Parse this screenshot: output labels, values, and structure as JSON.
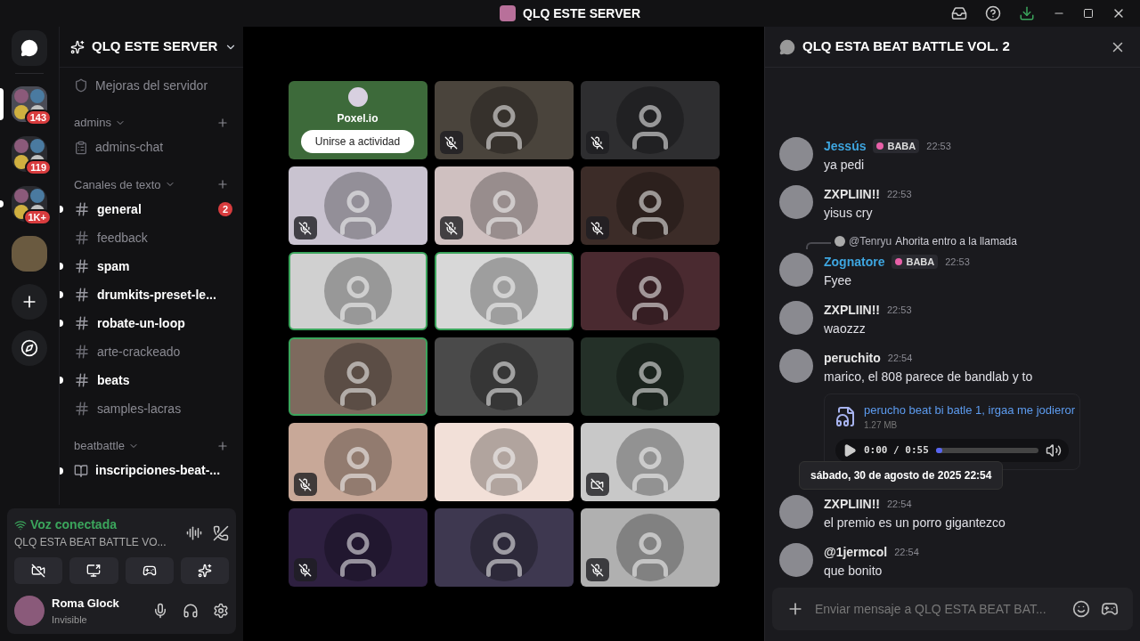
{
  "window": {
    "title": "QLQ ESTE SERVER"
  },
  "servers": [
    {
      "kind": "folder",
      "badge": "143",
      "selected": true,
      "unread": false
    },
    {
      "kind": "folder",
      "badge": "119",
      "selected": false,
      "unread": false
    },
    {
      "kind": "folder",
      "badge": "1K+",
      "selected": false,
      "unread": true
    },
    {
      "kind": "server",
      "selected": false,
      "unread": false
    }
  ],
  "sidebar": {
    "server_name": "QLQ ESTE SERVER",
    "items": [
      {
        "kind": "boost",
        "name": "Mejoras del servidor",
        "unread": false
      },
      {
        "kind": "category",
        "name": "admins"
      },
      {
        "kind": "forum",
        "name": "admins-chat",
        "unread": false
      },
      {
        "kind": "category",
        "name": "Canales de texto"
      },
      {
        "kind": "text",
        "name": "general",
        "unread": true,
        "badge": "2"
      },
      {
        "kind": "text",
        "name": "feedback",
        "unread": false
      },
      {
        "kind": "text",
        "name": "spam",
        "unread": true
      },
      {
        "kind": "text",
        "name": "drumkits-preset-le...",
        "unread": true
      },
      {
        "kind": "text",
        "name": "robate-un-loop",
        "unread": true
      },
      {
        "kind": "text",
        "name": "arte-crackeado",
        "unread": false
      },
      {
        "kind": "text",
        "name": "beats",
        "unread": true
      },
      {
        "kind": "text",
        "name": "samples-lacras",
        "unread": false
      },
      {
        "kind": "category",
        "name": "beatbattle"
      },
      {
        "kind": "rules",
        "name": "inscripciones-beat-...",
        "unread": true
      }
    ]
  },
  "voice": {
    "status": "Voz conectada",
    "channel": "QLQ ESTA BEAT BATTLE VO..."
  },
  "user": {
    "name": "Roma Glock",
    "status": "Invisible"
  },
  "tiles": [
    {
      "kind": "activity",
      "title": "Poxel.io",
      "button": "Unirse a actividad",
      "color": "#3d6a3a",
      "speaking": false
    },
    {
      "kind": "user",
      "color": "#4a443c",
      "speaking": false,
      "muted": true,
      "camera_off": false
    },
    {
      "kind": "user",
      "color": "#2e2e30",
      "speaking": false,
      "muted": true,
      "camera_off": false
    },
    {
      "kind": "user",
      "color": "#c9c3d0",
      "speaking": false,
      "muted": true,
      "camera_off": false
    },
    {
      "kind": "user",
      "color": "#cfc0c0",
      "speaking": false,
      "muted": true,
      "camera_off": false
    },
    {
      "kind": "user",
      "color": "#3c2c28",
      "speaking": false,
      "muted": true,
      "camera_off": false
    },
    {
      "kind": "user",
      "color": "#d0d0d0",
      "speaking": true,
      "muted": false,
      "camera_off": false
    },
    {
      "kind": "user",
      "color": "#d8d8d8",
      "speaking": true,
      "muted": false,
      "camera_off": false
    },
    {
      "kind": "user",
      "color": "#4a2a30",
      "speaking": false,
      "muted": false,
      "camera_off": false
    },
    {
      "kind": "user",
      "color": "#7d6a5e",
      "speaking": true,
      "muted": false,
      "camera_off": false
    },
    {
      "kind": "user",
      "color": "#4a4a4a",
      "speaking": false,
      "muted": false,
      "camera_off": false
    },
    {
      "kind": "user",
      "color": "#243028",
      "speaking": false,
      "muted": false,
      "camera_off": false
    },
    {
      "kind": "user",
      "color": "#c8a898",
      "speaking": false,
      "muted": true,
      "camera_off": false
    },
    {
      "kind": "user",
      "color": "#f2e0d8",
      "speaking": false,
      "muted": false,
      "camera_off": false
    },
    {
      "kind": "user",
      "color": "#c8c8c8",
      "speaking": false,
      "muted": false,
      "camera_off": true
    },
    {
      "kind": "user",
      "color": "#2e2040",
      "speaking": false,
      "muted": true,
      "camera_off": false
    },
    {
      "kind": "user",
      "color": "#3e3850",
      "speaking": false,
      "muted": false,
      "camera_off": false
    },
    {
      "kind": "user",
      "color": "#b0b0b0",
      "speaking": false,
      "muted": true,
      "camera_off": false
    }
  ],
  "chat": {
    "title": "QLQ ESTA BEAT BATTLE VOL. 2",
    "messages": [
      {
        "author": "Jessús",
        "color": "#3ea6e0",
        "tag": "BABA",
        "time": "22:53",
        "text": "ya pedi"
      },
      {
        "author": "ZXPLIIN!!",
        "color": "#e6e6e6",
        "time": "22:53",
        "text": "yisus cry"
      },
      {
        "author": "Zognatore",
        "color": "#3ea6e0",
        "tag": "BABA",
        "time": "22:53",
        "text": "Fyee",
        "reply": {
          "user": "@Tenryu",
          "text": "Ahorita entro a la llamada"
        }
      },
      {
        "author": "ZXPLIIN!!",
        "color": "#e6e6e6",
        "time": "22:53",
        "text": "waozzz"
      },
      {
        "author": "peruchito",
        "color": "#e6e6e6",
        "time": "22:54",
        "text": "marico, el 808 parece de bandlab y to",
        "attachment": {
          "name": "perucho beat bi batle 1, irgaa me jodieror",
          "size": "1.27 MB",
          "time": "0:00 / 0:55",
          "level": 0.06
        }
      },
      {
        "author": "ZXPLIIN!!",
        "color": "#e6e6e6",
        "time": "22:54",
        "text": "el premio es un porro gigantezco",
        "tooltip": "sábado, 30 de agosto de 2025 22:54"
      },
      {
        "author": "@1jermcol",
        "color": "#e6e6e6",
        "time": "22:54",
        "text": "que bonito"
      }
    ],
    "placeholder": "Enviar mensaje a QLQ ESTA BEAT BAT..."
  }
}
